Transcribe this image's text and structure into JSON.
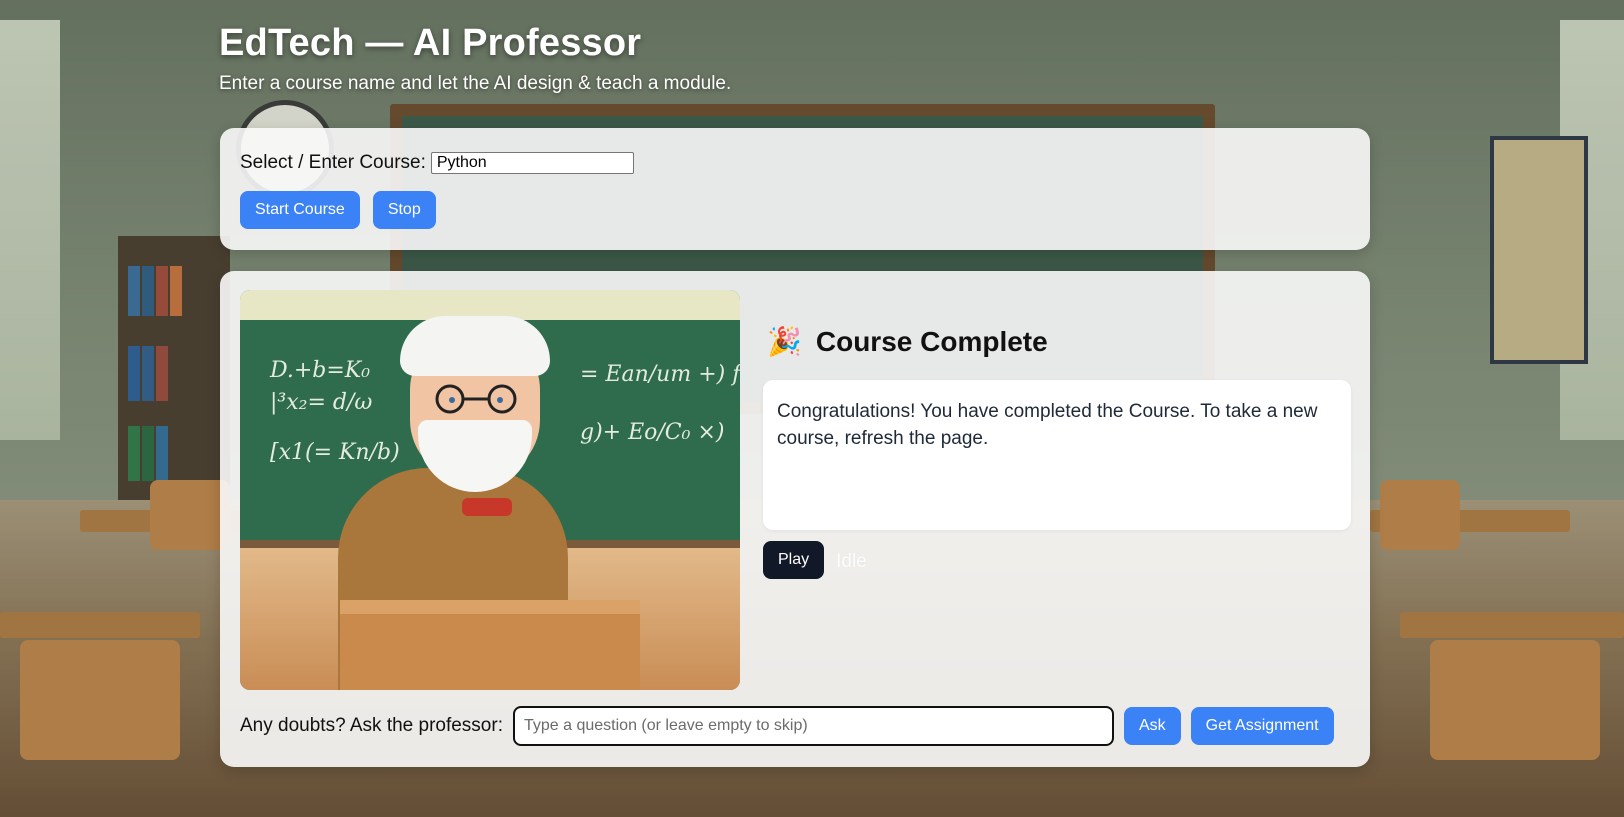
{
  "header": {
    "title": "EdTech — AI Professor",
    "subtitle": "Enter a course name and let the AI design & teach a module."
  },
  "course": {
    "label": "Select / Enter Course:",
    "value": "Python",
    "start_label": "Start Course",
    "stop_label": "Stop"
  },
  "lesson": {
    "heading_icon": "party-popper-icon",
    "heading": "Course Complete",
    "message": "Congratulations! You have completed the Course. To take a new course, refresh the page.",
    "play_label": "Play",
    "status": "Idle"
  },
  "ask": {
    "label": "Any doubts? Ask the professor:",
    "placeholder": "Type a question (or leave empty to skip)",
    "value": "",
    "ask_label": "Ask",
    "assignment_label": "Get Assignment"
  },
  "colors": {
    "primary": "#3b82f6",
    "dark": "#111827"
  }
}
